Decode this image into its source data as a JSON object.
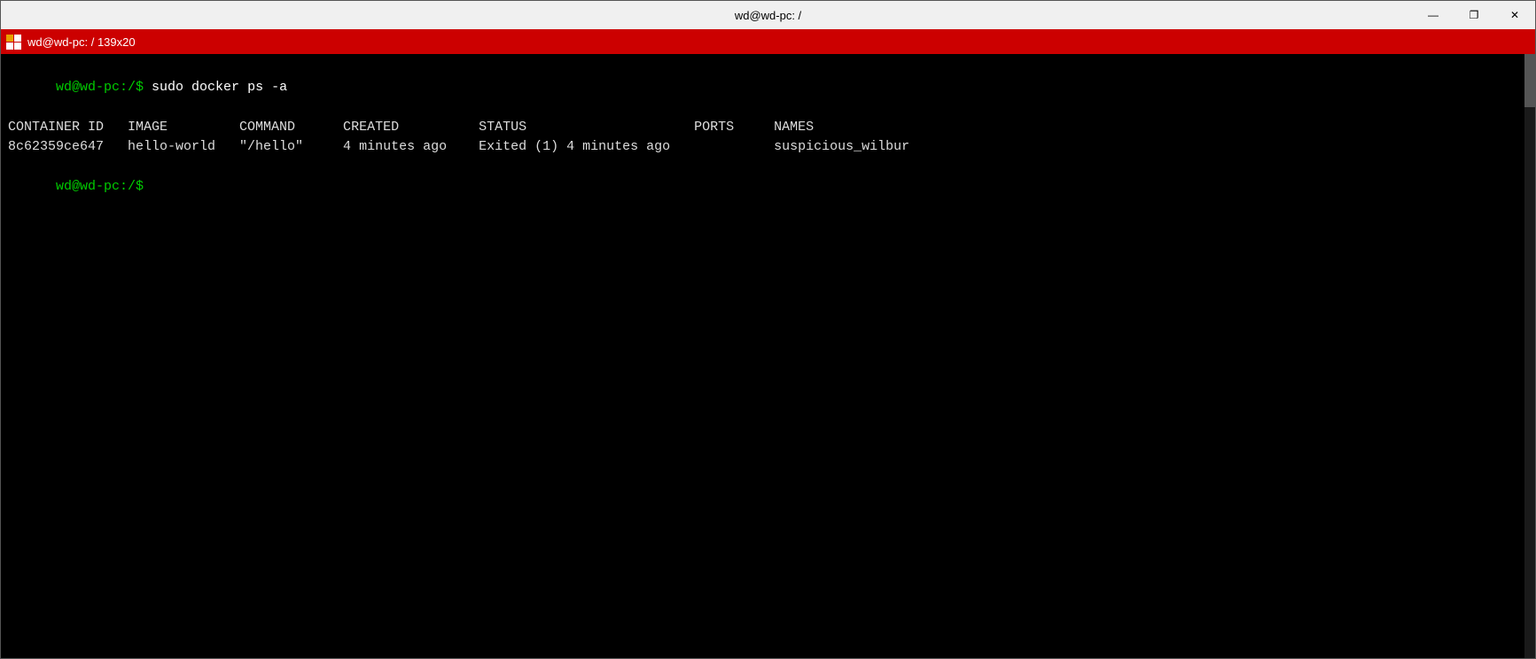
{
  "window": {
    "title": "wd@wd-pc: /",
    "tab_label": "wd@wd-pc: / 139x20",
    "minimize_label": "—",
    "restore_label": "❐",
    "close_label": "✕"
  },
  "terminal": {
    "prompt1": "wd@wd-pc:/$ ",
    "command": "sudo docker ps -a",
    "headers": {
      "container_id": "CONTAINER ID",
      "image": "IMAGE",
      "command": "COMMAND",
      "created": "CREATED",
      "status": "STATUS",
      "ports": "PORTS",
      "names": "NAMES"
    },
    "row": {
      "container_id": "8c62359ce647",
      "image": "hello-world",
      "command": "\"/hello\"",
      "created": "4 minutes ago",
      "status": "Exited (1) 4 minutes ago",
      "ports": "",
      "names": "suspicious_wilbur"
    },
    "prompt2": "wd@wd-pc:/$ "
  }
}
